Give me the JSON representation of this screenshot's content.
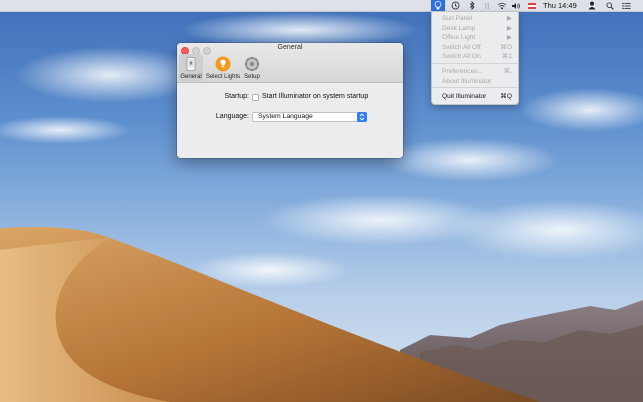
{
  "menubar": {
    "clock": "Thu 14:49",
    "icons": [
      "illuminator-bulb-icon",
      "time-machine-icon",
      "bluetooth-icon",
      "pause-icon",
      "wifi-icon",
      "volume-icon",
      "flag-icon",
      "user-icon",
      "spotlight-search-icon",
      "notification-center-icon"
    ],
    "accent_color": "#2f6fe0"
  },
  "menu": {
    "items": [
      {
        "label": "Sun Panel",
        "shortcut": "▶",
        "enabled": false
      },
      {
        "label": "Desk Lamp",
        "shortcut": "▶",
        "enabled": false
      },
      {
        "label": "Office Light",
        "shortcut": "▶",
        "enabled": false
      },
      {
        "label": "Switch All Off",
        "shortcut": "⌘O",
        "enabled": false
      },
      {
        "label": "Switch All On",
        "shortcut": "⌘1",
        "enabled": false
      },
      {
        "label": "Preferences...",
        "shortcut": "⌘,",
        "enabled": false
      },
      {
        "label": "About Illuminator",
        "shortcut": "",
        "enabled": false
      },
      {
        "label": "Quit Illuminator",
        "shortcut": "⌘Q",
        "enabled": true
      }
    ]
  },
  "window": {
    "title": "General",
    "toolbar": [
      {
        "label": "General",
        "icon": "phone-icon",
        "selected": true
      },
      {
        "label": "Select Lights",
        "icon": "lightbulb-icon",
        "selected": false
      },
      {
        "label": "Setup",
        "icon": "gear-icon",
        "selected": false
      }
    ],
    "startup_label": "Startup:",
    "startup_checkbox_label": "Start Illuminator on system startup",
    "startup_checked": false,
    "language_label": "Language:",
    "language_value": "System Language"
  }
}
